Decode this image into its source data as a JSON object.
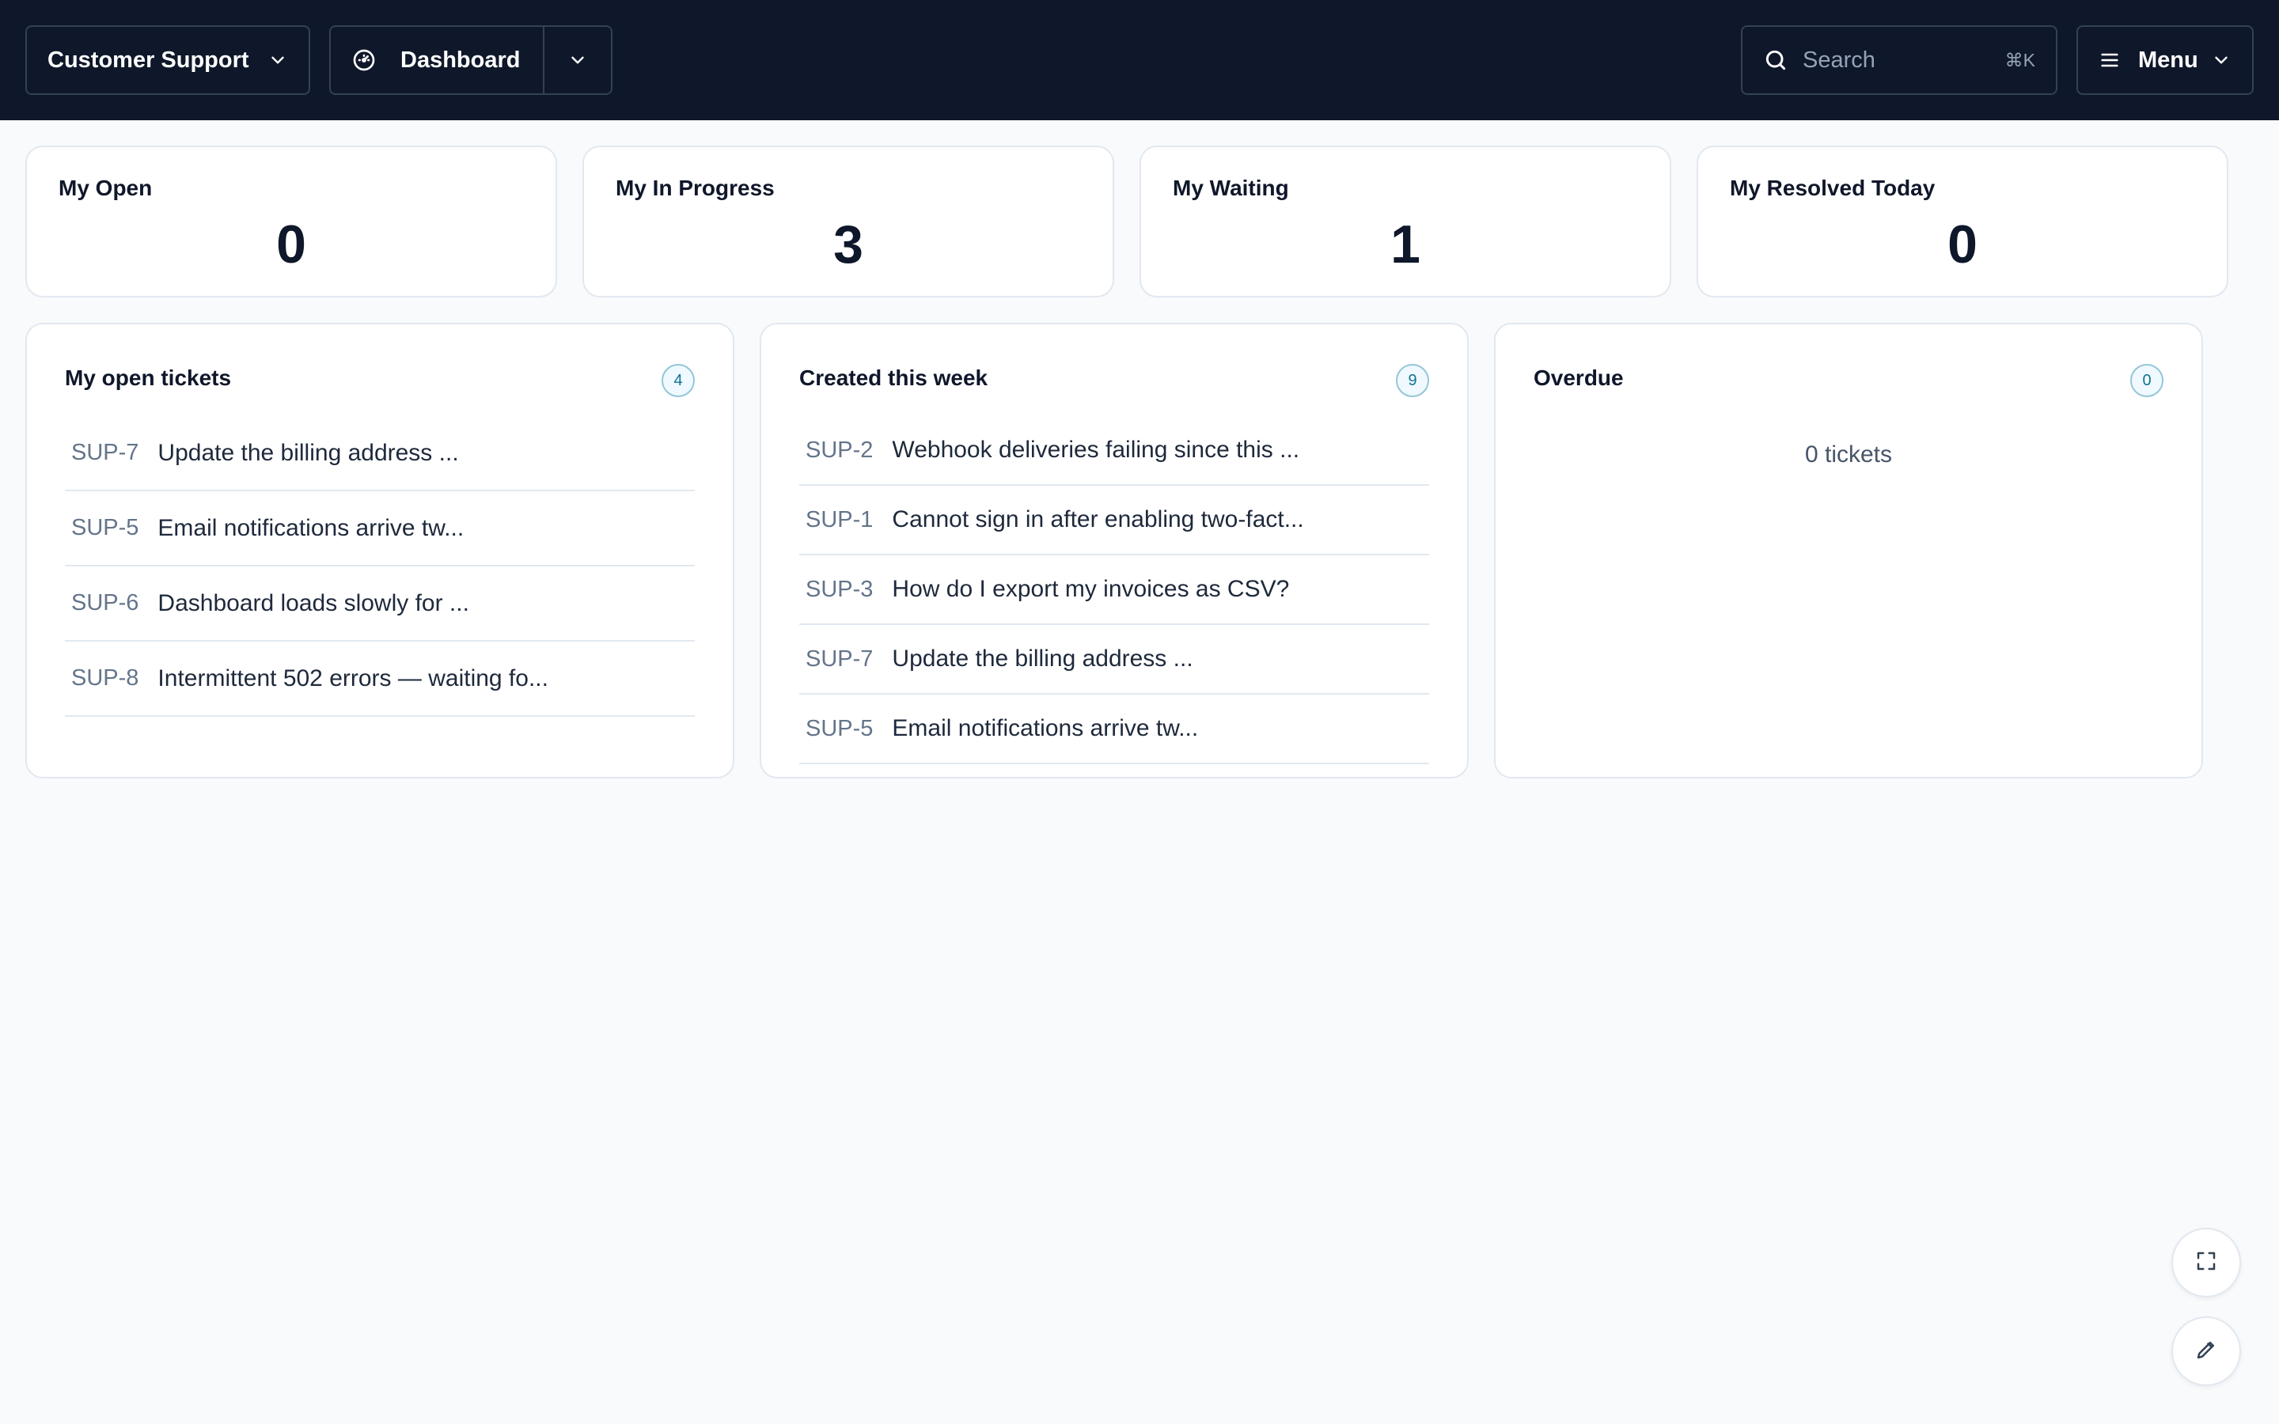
{
  "header": {
    "workspace_label": "Customer Support",
    "view_label": "Dashboard",
    "search_placeholder": "Search",
    "search_shortcut": "⌘K",
    "menu_label": "Menu"
  },
  "stats": [
    {
      "label": "My Open",
      "value": "0"
    },
    {
      "label": "My In Progress",
      "value": "3"
    },
    {
      "label": "My Waiting",
      "value": "1"
    },
    {
      "label": "My Resolved Today",
      "value": "0"
    }
  ],
  "panels": {
    "open": {
      "title": "My open tickets",
      "count": "4",
      "tickets": [
        {
          "key": "SUP-7",
          "summary": "Update the billing address ..."
        },
        {
          "key": "SUP-5",
          "summary": "Email notifications arrive tw..."
        },
        {
          "key": "SUP-6",
          "summary": "Dashboard loads slowly for ..."
        },
        {
          "key": "SUP-8",
          "summary": "Intermittent 502 errors — waiting fo..."
        }
      ]
    },
    "week": {
      "title": "Created this week",
      "count": "9",
      "tickets": [
        {
          "key": "SUP-2",
          "summary": "Webhook deliveries failing since this ..."
        },
        {
          "key": "SUP-1",
          "summary": "Cannot sign in after enabling two-fact..."
        },
        {
          "key": "SUP-3",
          "summary": "How do I export my invoices as CSV?"
        },
        {
          "key": "SUP-7",
          "summary": "Update the billing address ..."
        },
        {
          "key": "SUP-5",
          "summary": "Email notifications arrive tw..."
        }
      ]
    },
    "overdue": {
      "title": "Overdue",
      "count": "0",
      "empty_text": "0 tickets"
    }
  },
  "colors": {
    "topbar": "#0f172a",
    "background": "#f8fafc",
    "accent": "#0e7490"
  },
  "icons": {
    "workspace": "chevron-down-icon",
    "dashboard": "gauge-icon",
    "search": "search-icon",
    "menu": "hamburger-icon",
    "fullscreen": "expand-icon",
    "edit": "pencil-icon"
  }
}
